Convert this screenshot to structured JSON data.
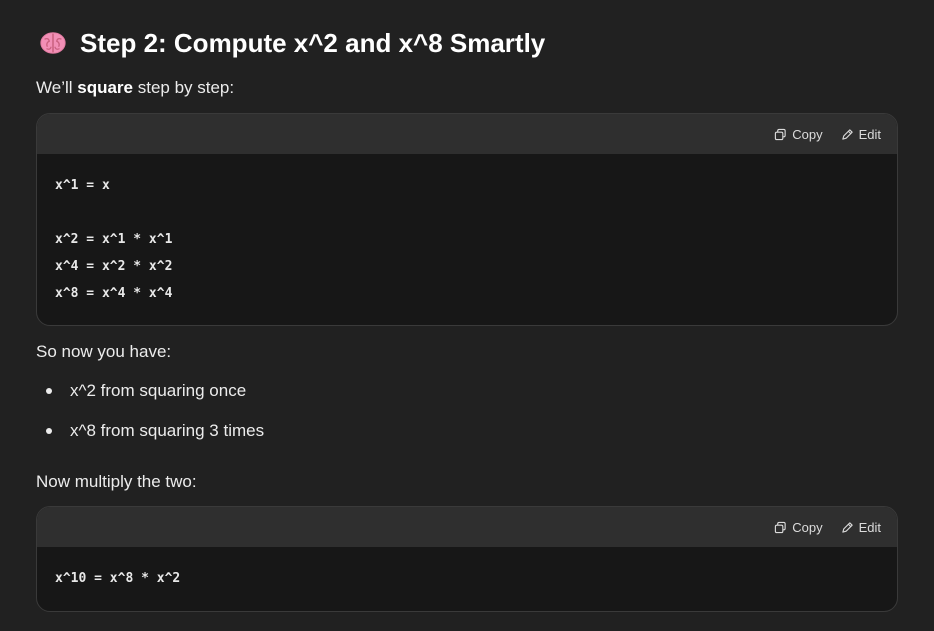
{
  "heading": {
    "icon": "brain-icon",
    "title": "Step 2: Compute x^2 and x^8 Smartly"
  },
  "intro": {
    "prefix": "We’ll ",
    "bold": "square",
    "suffix": " step by step:"
  },
  "code_block_1": {
    "copy_label": "Copy",
    "edit_label": "Edit",
    "lines": [
      "x^1 = x",
      "",
      "x^2 = x^1 * x^1",
      "x^4 = x^2 * x^2",
      "x^8 = x^4 * x^4"
    ]
  },
  "so_now": "So now you have:",
  "bullets": [
    "x^2 from squaring once",
    "x^8 from squaring 3 times"
  ],
  "multiply": "Now multiply the two:",
  "code_block_2": {
    "copy_label": "Copy",
    "edit_label": "Edit",
    "lines": [
      "x^10 = x^8 * x^2"
    ]
  },
  "colors": {
    "background": "#212121",
    "code_bg": "#171717",
    "code_header_bg": "#2f2f2f",
    "brain_pink": "#f28fb6"
  }
}
